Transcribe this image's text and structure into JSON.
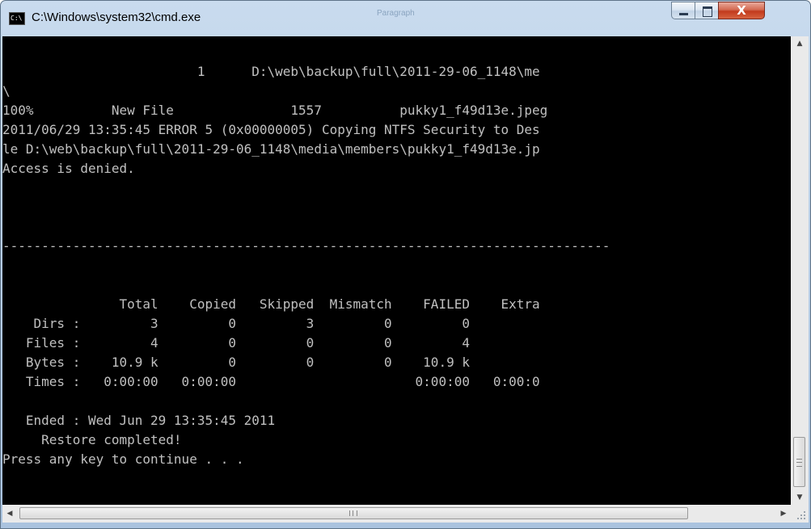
{
  "window": {
    "title": "C:\\Windows\\system32\\cmd.exe",
    "icon_text": "C:\\",
    "ghost_tab": "Paragraph"
  },
  "controls": {
    "minimize_icon": "minimize-icon",
    "maximize_icon": "maximize-icon",
    "close_glyph": "X"
  },
  "console": {
    "fg_color": "#c0c0c0",
    "bg_color": "#000000",
    "lines": [
      "",
      "                         1      D:\\web\\backup\\full\\2011-29-06_1148\\me",
      "\\",
      "100%          New File               1557          pukky1_f49d13e.jpeg",
      "2011/06/29 13:35:45 ERROR 5 (0x00000005) Copying NTFS Security to Des",
      "le D:\\web\\backup\\full\\2011-29-06_1148\\media\\members\\pukky1_f49d13e.jp",
      "Access is denied.",
      "",
      "",
      "",
      "------------------------------------------------------------------------------",
      "",
      "",
      "               Total    Copied   Skipped  Mismatch    FAILED    Extra",
      "    Dirs :         3         0         3         0         0",
      "   Files :         4         0         0         0         4",
      "   Bytes :    10.9 k         0         0         0    10.9 k",
      "   Times :   0:00:00   0:00:00                       0:00:00   0:00:0",
      "",
      "   Ended : Wed Jun 29 13:35:45 2011",
      "     Restore completed!",
      "Press any key to continue . . ."
    ]
  },
  "scrollbars": {
    "up_arrow": "▲",
    "down_arrow": "▼",
    "left_arrow": "◀",
    "right_arrow": "▶"
  }
}
